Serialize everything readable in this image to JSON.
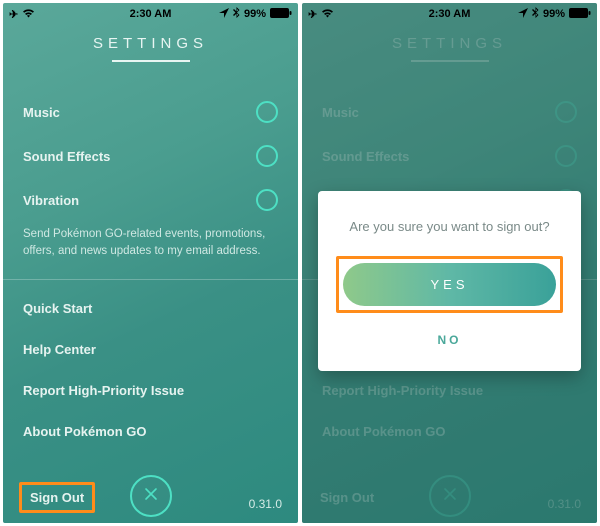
{
  "status": {
    "time": "2:30 AM",
    "battery": "99%"
  },
  "header": {
    "title": "SETTINGS"
  },
  "toggles": [
    {
      "label": "Music"
    },
    {
      "label": "Sound Effects"
    },
    {
      "label": "Vibration"
    }
  ],
  "emailDesc": "Send Pokémon GO-related events, promotions, offers, and news updates to my email address.",
  "links": [
    {
      "label": "Quick Start"
    },
    {
      "label": "Help Center"
    },
    {
      "label": "Report High-Priority Issue"
    },
    {
      "label": "About Pokémon GO"
    }
  ],
  "signOut": "Sign Out",
  "version": "0.31.0",
  "modal": {
    "message": "Are you sure you want to sign out?",
    "yes": "YES",
    "no": "NO"
  }
}
